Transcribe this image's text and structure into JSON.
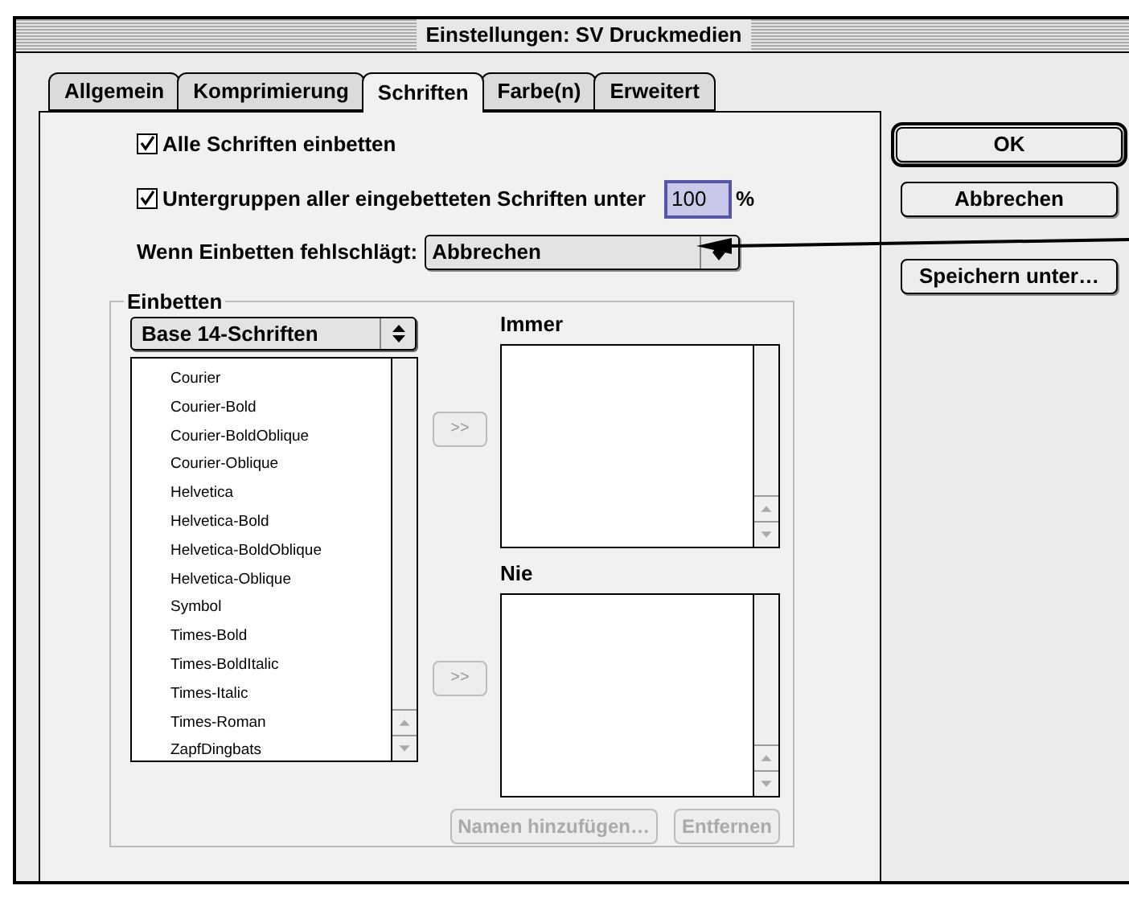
{
  "window": {
    "title": "Einstellungen: SV Druckmedien"
  },
  "tabs": [
    {
      "label": "Allgemein",
      "selected": false
    },
    {
      "label": "Komprimierung",
      "selected": false
    },
    {
      "label": "Schriften",
      "selected": true
    },
    {
      "label": "Farbe(n)",
      "selected": false
    },
    {
      "label": "Erweitert",
      "selected": false
    }
  ],
  "embed_all": {
    "label": "Alle Schriften einbetten",
    "checked": true
  },
  "subset": {
    "label": "Untergruppen aller eingebetteten Schriften unter",
    "checked": true,
    "value": "100",
    "unit": "%"
  },
  "on_failure": {
    "label": "Wenn Einbetten fehlschlägt:",
    "value": "Abbrechen"
  },
  "embed_group": {
    "title": "Einbetten",
    "font_set": "Base 14-Schriften",
    "fonts": [
      "Courier",
      "Courier-Bold",
      "Courier-BoldOblique",
      "Courier-Oblique",
      "Helvetica",
      "Helvetica-Bold",
      "Helvetica-BoldOblique",
      "Helvetica-Oblique",
      "Symbol",
      "Times-Bold",
      "Times-BoldItalic",
      "Times-Italic",
      "Times-Roman",
      "ZapfDingbats"
    ],
    "lists": [
      {
        "label": "Immer",
        "add_button": {
          "label": ">>",
          "disabled": true
        }
      },
      {
        "label": "Nie",
        "add_button": {
          "label": ">>",
          "disabled": true
        }
      }
    ],
    "actions": [
      {
        "label": "Namen hinzufügen…",
        "disabled": true
      },
      {
        "label": "Entfernen",
        "disabled": true
      }
    ]
  },
  "buttons": [
    {
      "label": "OK",
      "default": true
    },
    {
      "label": "Abbrechen",
      "default": false
    },
    {
      "label": "Speichern unter…",
      "default": false
    }
  ]
}
